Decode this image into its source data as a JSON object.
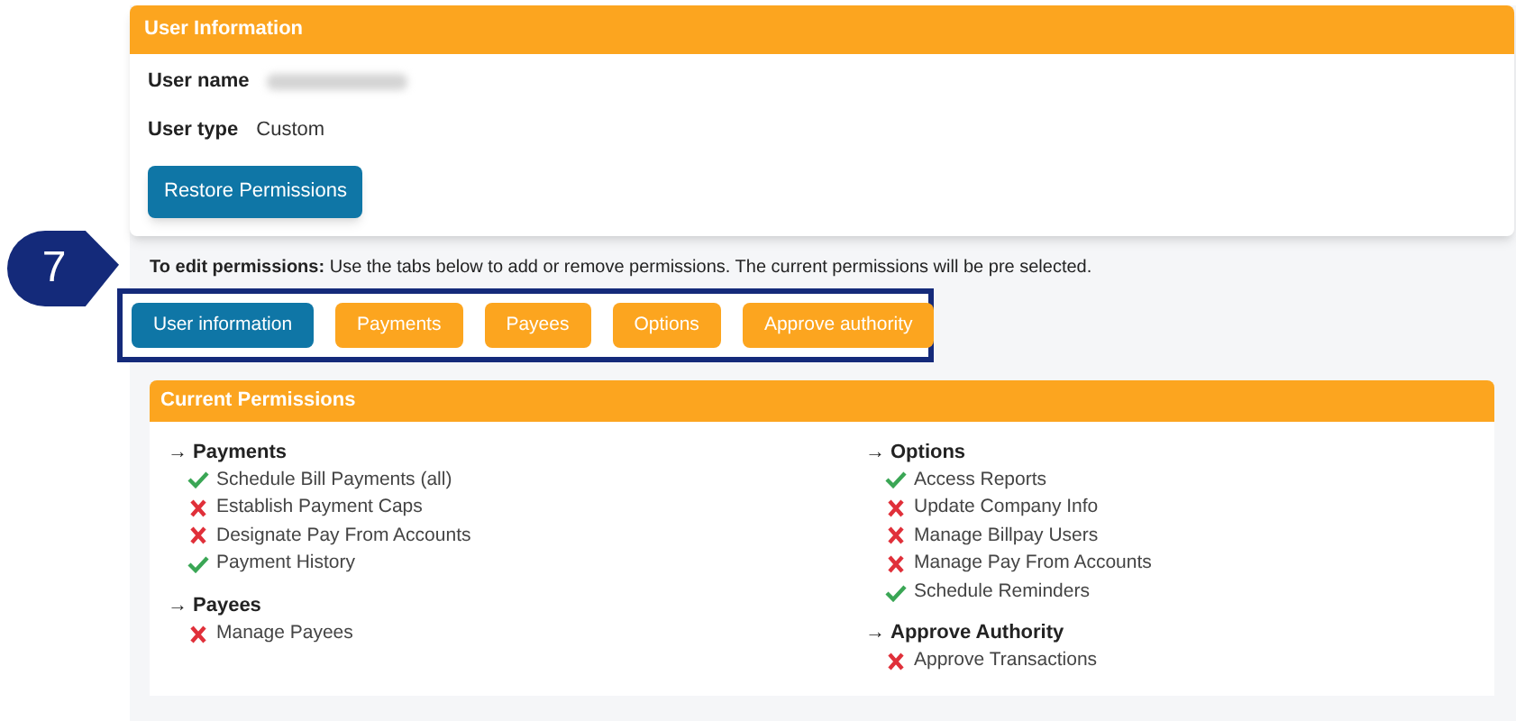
{
  "step_badge": "7",
  "user_information": {
    "title": "User Information",
    "fields": [
      {
        "label": "User name",
        "redacted": true
      },
      {
        "label": "User type",
        "value": "Custom",
        "redacted": false
      }
    ],
    "restore_button": "Restore Permissions"
  },
  "instructions": {
    "lead": "To edit permissions:",
    "text": "Use the tabs below to add or remove permissions. The current permissions will be pre selected."
  },
  "tabs": [
    {
      "label": "User information",
      "selected": true
    },
    {
      "label": "Payments",
      "selected": false
    },
    {
      "label": "Payees",
      "selected": false
    },
    {
      "label": "Options",
      "selected": false
    },
    {
      "label": "Approve authority",
      "selected": false
    }
  ],
  "current_permissions": {
    "title": "Current Permissions",
    "columns": [
      [
        {
          "marker": "→",
          "heading": "Payments",
          "items": [
            {
              "label": "Schedule Bill Payments (all)",
              "granted": true
            },
            {
              "label": "Establish Payment Caps",
              "granted": false
            },
            {
              "label": "Designate Pay From Accounts",
              "granted": false
            },
            {
              "label": "Payment History",
              "granted": true
            }
          ]
        },
        {
          "marker": "→",
          "heading": "Payees",
          "items": [
            {
              "label": "Manage Payees",
              "granted": false
            }
          ]
        }
      ],
      [
        {
          "marker": "→",
          "heading": "Options",
          "items": [
            {
              "label": "Access Reports",
              "granted": true
            },
            {
              "label": "Update Company Info",
              "granted": false
            },
            {
              "label": "Manage Billpay Users",
              "granted": false
            },
            {
              "label": "Manage Pay From Accounts",
              "granted": false
            },
            {
              "label": "Schedule Reminders",
              "granted": true
            }
          ]
        },
        {
          "marker": "→",
          "heading": "Approve Authority",
          "items": [
            {
              "label": "Approve Transactions",
              "granted": false
            }
          ]
        }
      ]
    ]
  }
}
